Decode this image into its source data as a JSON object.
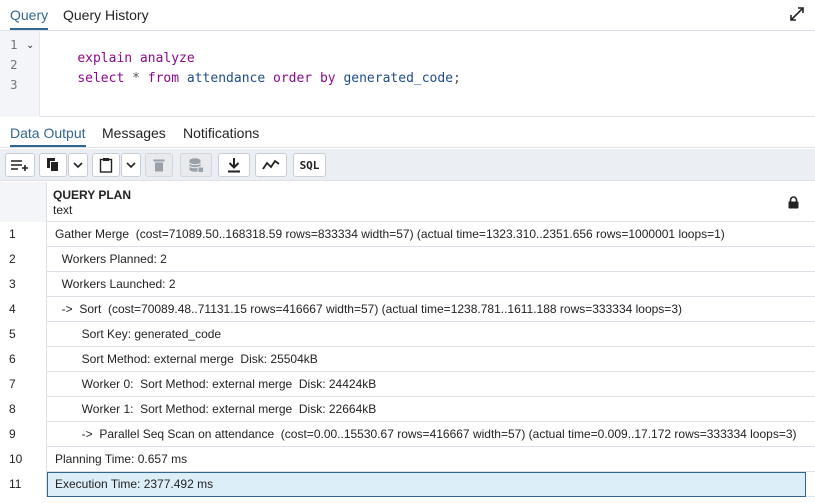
{
  "top_tabs": [
    {
      "label": "Query",
      "active": true
    },
    {
      "label": "Query History",
      "active": false
    }
  ],
  "icons": {
    "expand": "expand-arrows-icon",
    "fold": "chevron-down-icon",
    "lock": "lock-icon"
  },
  "editor": {
    "line_numbers": [
      "1",
      "2",
      "3"
    ],
    "lines": [
      [
        {
          "text": "explain analyze",
          "kind": "kw"
        }
      ],
      [
        {
          "text": "select",
          "kind": "kw"
        },
        {
          "text": " * ",
          "kind": "op"
        },
        {
          "text": "from",
          "kind": "kw"
        },
        {
          "text": " attendance ",
          "kind": "id"
        },
        {
          "text": "order by",
          "kind": "kw"
        },
        {
          "text": " generated_code",
          "kind": "id"
        },
        {
          "text": ";",
          "kind": "op"
        }
      ],
      []
    ]
  },
  "output_tabs": [
    {
      "label": "Data Output",
      "active": true
    },
    {
      "label": "Messages",
      "active": false
    },
    {
      "label": "Notifications",
      "active": false
    }
  ],
  "toolbar": {
    "sql_label": "SQL",
    "buttons": [
      "add-row-icon",
      "copy-icon",
      "chevron-down-icon",
      "paste-icon",
      "chevron-down-icon",
      "delete-icon",
      "save-data-icon",
      "download-icon",
      "graph-icon",
      "sql-text"
    ]
  },
  "grid": {
    "column": {
      "title": "QUERY PLAN",
      "type": "text"
    },
    "rows": [
      {
        "num": "1",
        "value": "Gather Merge  (cost=71089.50..168318.59 rows=833334 width=57) (actual time=1323.310..2351.656 rows=1000001 loops=1)"
      },
      {
        "num": "2",
        "value": "  Workers Planned: 2"
      },
      {
        "num": "3",
        "value": "  Workers Launched: 2"
      },
      {
        "num": "4",
        "value": "  ->  Sort  (cost=70089.48..71131.15 rows=416667 width=57) (actual time=1238.781..1611.188 rows=333334 loops=3)"
      },
      {
        "num": "5",
        "value": "        Sort Key: generated_code"
      },
      {
        "num": "6",
        "value": "        Sort Method: external merge  Disk: 25504kB"
      },
      {
        "num": "7",
        "value": "        Worker 0:  Sort Method: external merge  Disk: 24424kB"
      },
      {
        "num": "8",
        "value": "        Worker 1:  Sort Method: external merge  Disk: 22664kB"
      },
      {
        "num": "9",
        "value": "        ->  Parallel Seq Scan on attendance  (cost=0.00..15530.67 rows=416667 width=57) (actual time=0.009..17.172 rows=333334 loops=3)"
      },
      {
        "num": "10",
        "value": "Planning Time: 0.657 ms"
      },
      {
        "num": "11",
        "value": "Execution Time: 2377.492 ms"
      }
    ],
    "selected_row": "11"
  },
  "colors": {
    "accent": "#326690",
    "keyword": "#8b0a8b",
    "identifier": "#1f4c8a",
    "selection": "#dceef8"
  }
}
